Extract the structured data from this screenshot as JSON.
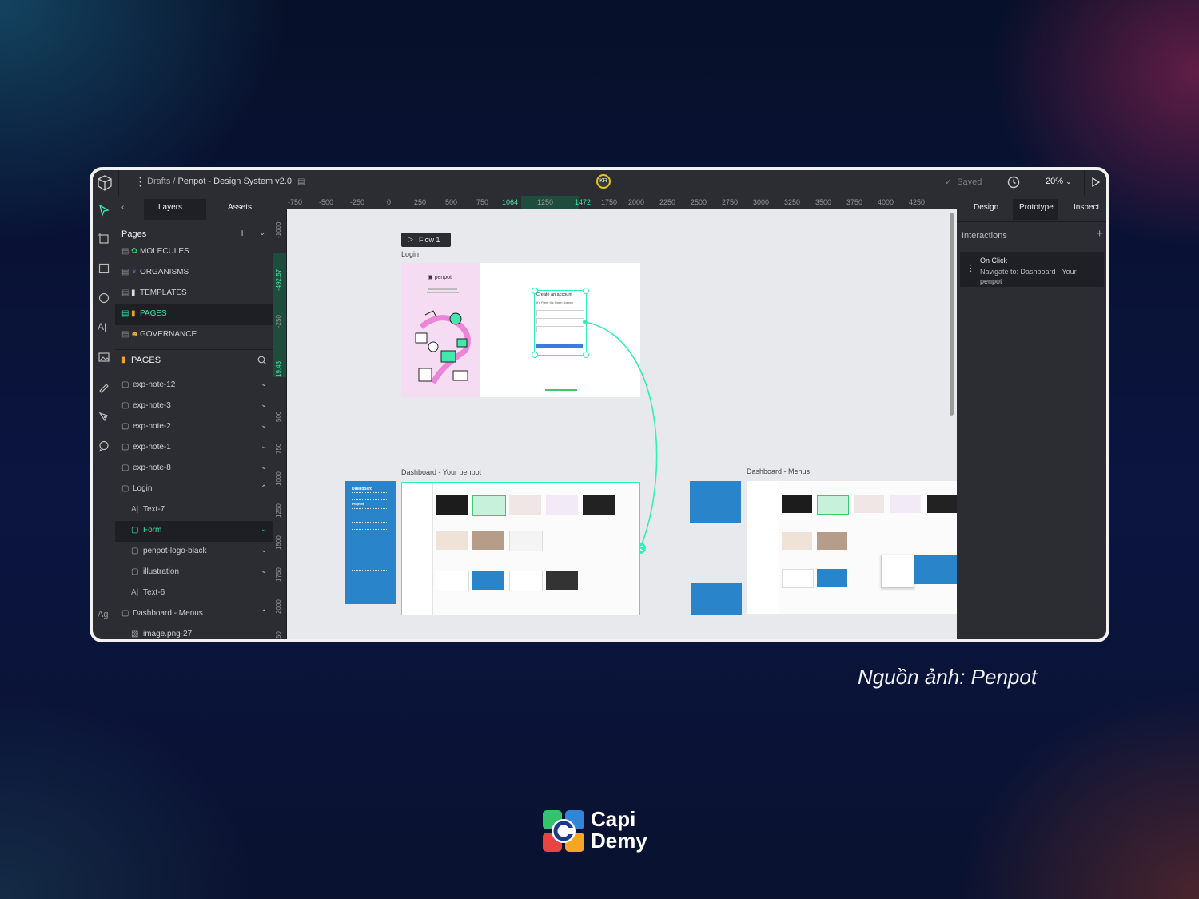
{
  "app": {
    "breadcrumb_path": "Drafts /",
    "file_title": "Penpot - Design System v2.0",
    "avatar_initials": "KR",
    "saved_label": "Saved",
    "zoom": "20%"
  },
  "left_tabs": {
    "layers": "Layers",
    "assets": "Assets"
  },
  "pages": {
    "heading": "Pages",
    "items": [
      {
        "label": "MOLECULES"
      },
      {
        "label": "ORGANISMS"
      },
      {
        "label": "TEMPLATES"
      },
      {
        "label": "PAGES"
      },
      {
        "label": "GOVERNANCE"
      }
    ]
  },
  "layer_tree": {
    "heading": "PAGES",
    "items": [
      {
        "label": "exp-note-12"
      },
      {
        "label": "exp-note-3"
      },
      {
        "label": "exp-note-2"
      },
      {
        "label": "exp-note-1"
      },
      {
        "label": "exp-note-8"
      },
      {
        "label": "Login"
      },
      {
        "label": "Text-7"
      },
      {
        "label": "Form"
      },
      {
        "label": "penpot-logo-black"
      },
      {
        "label": "illustration"
      },
      {
        "label": "Text-6"
      },
      {
        "label": "Dashboard - Menus"
      },
      {
        "label": "image.png-27"
      }
    ]
  },
  "ruler_top": [
    "-750",
    "-500",
    "-250",
    "0",
    "250",
    "500",
    "750",
    "1064",
    "1250",
    "1472",
    "1750",
    "2000",
    "2250",
    "2500",
    "2750",
    "3000",
    "3250",
    "3500",
    "3750",
    "4000",
    "4250"
  ],
  "ruler_left": [
    "-1000",
    "-492.57",
    "-250",
    "19.43",
    "500",
    "750",
    "1000",
    "1250",
    "1500",
    "1750",
    "2000",
    "2250"
  ],
  "canvas": {
    "flow_label": "Flow 1",
    "login_board": "Login",
    "penpot_brand": "penpot",
    "create_account": "Create an account",
    "open_source": "It's Free, It's Open Source",
    "board_dashboard": "Dashboard - Your penpot",
    "board_menus": "Dashboard - Menus",
    "note_dashboard": "Dashboard",
    "note_projects": "Projects"
  },
  "right_tabs": {
    "design": "Design",
    "prototype": "Prototype",
    "inspect": "Inspect"
  },
  "interactions": {
    "heading": "Interactions",
    "event": "On Click",
    "action_line1": "Navigate to: Dashboard - Your",
    "action_line2": "penpot"
  },
  "toolbar_bottom": "Ag",
  "caption": "Nguồn ảnh: Penpot",
  "brand": {
    "line1": "Capi",
    "line2": "Demy"
  },
  "colors": {
    "accent": "#31efb8",
    "blue_note": "#2a84c9"
  }
}
